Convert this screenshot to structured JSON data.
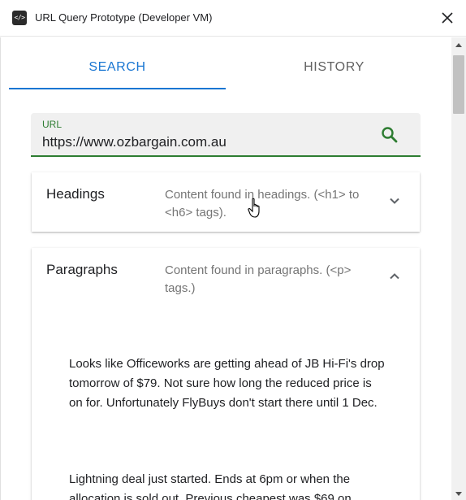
{
  "window": {
    "title": "URL Query Prototype (Developer VM)",
    "app_icon": "code-icon",
    "app_icon_glyph": "</>"
  },
  "tabs": [
    {
      "label": "SEARCH",
      "active": true
    },
    {
      "label": "HISTORY",
      "active": false
    }
  ],
  "url_field": {
    "label": "URL",
    "value": "https://www.ozbargain.com.au"
  },
  "panels": {
    "headings": {
      "title": "Headings",
      "description": "Content found in headings. (<h1> to <h6> tags).",
      "expanded": false
    },
    "paragraphs": {
      "title": "Paragraphs",
      "description": "Content found in paragraphs. (<p> tags.)",
      "expanded": true,
      "items": [
        "Looks like Officeworks are getting ahead of JB Hi-Fi's drop tomorrow of $79. Not sure how long the reduced price is on for. Unfortunately FlyBuys don't start there until 1 Dec.",
        "Lightning deal just started. Ends at 6pm or when the allocation is sold out. Previous cheapest was $69 on"
      ]
    }
  },
  "colors": {
    "accent_blue": "#1976d2",
    "accent_green": "#2e7d32",
    "field_bg": "#f0f0f0"
  },
  "icons": {
    "close": "close-icon",
    "search": "search-icon",
    "collapsed": "chevron-down-icon",
    "expanded": "chevron-up-icon",
    "pointer": "hand-pointer-icon"
  }
}
